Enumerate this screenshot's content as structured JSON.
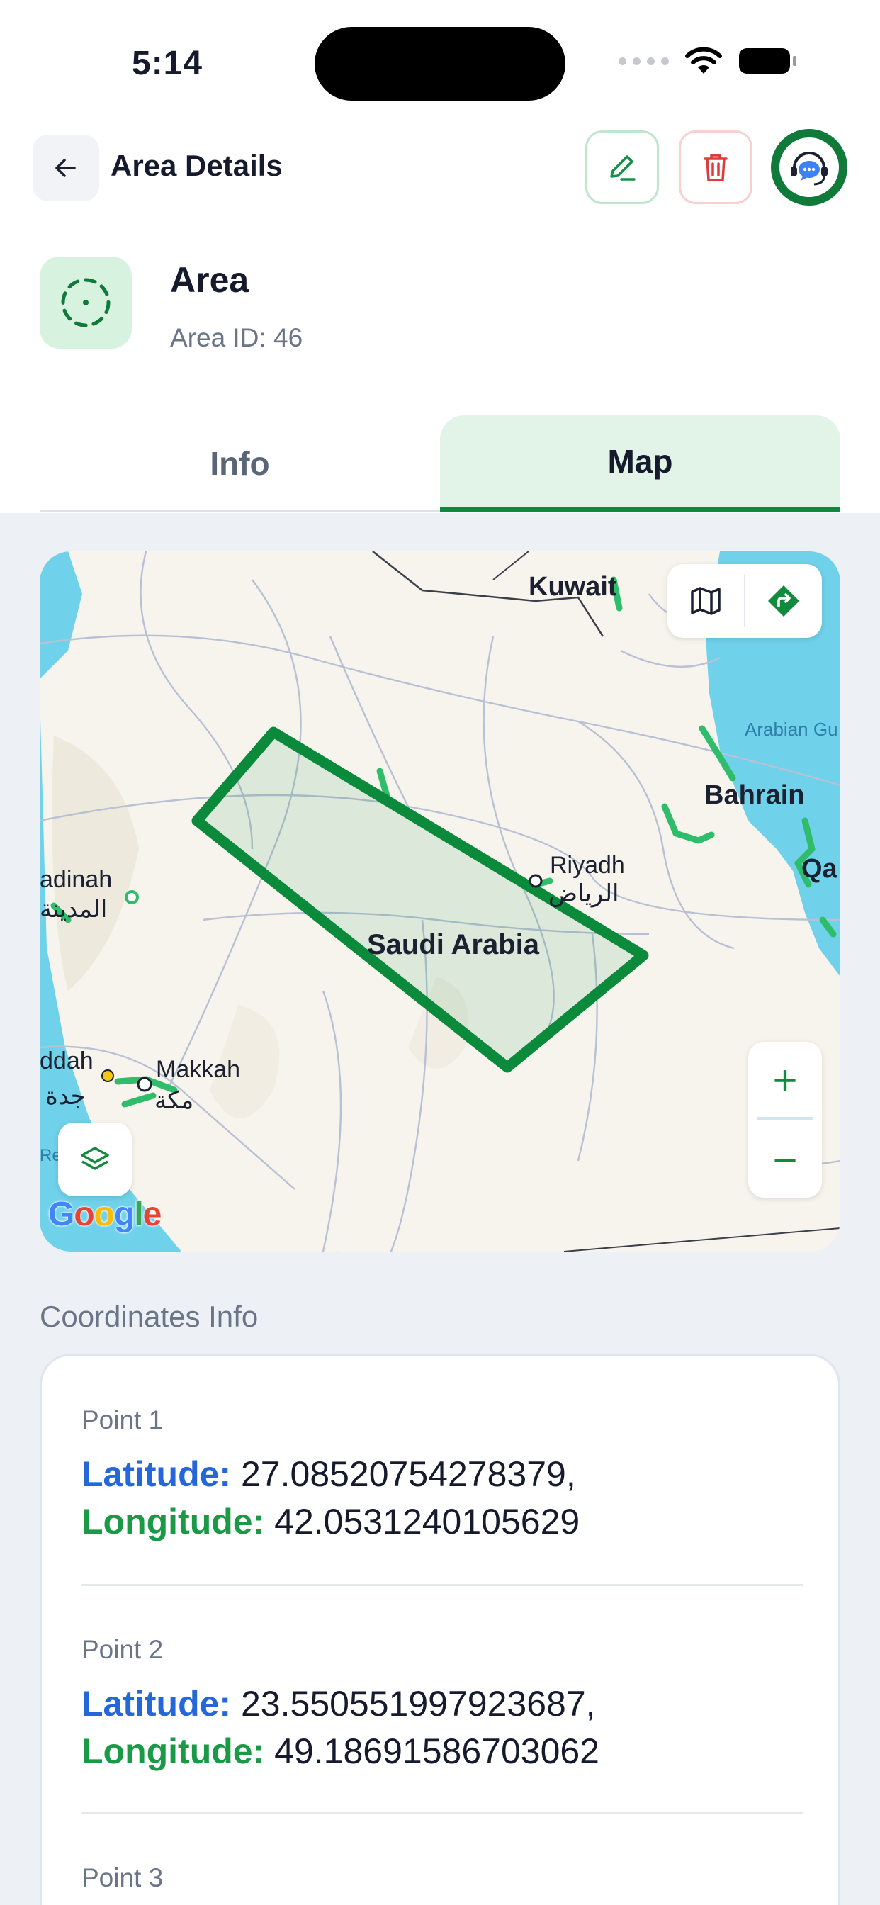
{
  "status_bar": {
    "time": "5:14"
  },
  "header": {
    "title": "Area Details",
    "icons": {
      "back": "arrow-left-icon",
      "edit": "pencil-icon",
      "delete": "trash-icon",
      "support": "headset-chat-icon"
    }
  },
  "area": {
    "name": "Area",
    "id_label": "Area ID: 46"
  },
  "tabs": [
    {
      "label": "Info",
      "active": false
    },
    {
      "label": "Map",
      "active": true
    }
  ],
  "map": {
    "labels": {
      "kuwait": "Kuwait",
      "arabian_gulf": "Arabian Gu",
      "bahrain": "Bahrain",
      "qatar": "Qa",
      "riyadh": "Riyadh",
      "riyadh_ar": "الرياض",
      "madinah": "adinah",
      "madinah_ar": "المدينة",
      "saudi": "Saudi Arabia",
      "jeddah": "ddah",
      "jeddah_ar": "جدة",
      "makkah": "Makkah",
      "makkah_ar": "مكة",
      "red_sea": "Rec"
    },
    "controls": {
      "map_type": "map-icon",
      "directions": "directions-icon",
      "zoom_in": "+",
      "zoom_out": "−",
      "layers": "layers-icon"
    },
    "colors": {
      "polygon_stroke": "#0b8a3c",
      "polygon_fill": "#e6efe2",
      "water": "#6fd1ea",
      "land": "#f7f4ee"
    }
  },
  "coordinates": {
    "title": "Coordinates Info",
    "lat_key": "Latitude:",
    "lng_key": "Longitude:",
    "points": [
      {
        "label": "Point 1",
        "lat": "27.08520754278379,",
        "lng": "42.0531240105629"
      },
      {
        "label": "Point 2",
        "lat": "23.550551997923687,",
        "lng": "49.18691586703062"
      },
      {
        "label": "Point 3"
      }
    ]
  }
}
